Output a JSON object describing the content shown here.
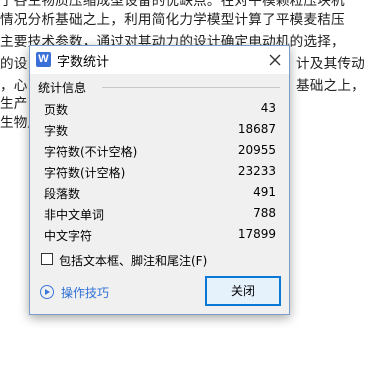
{
  "document": {
    "lines": [
      "了各生物质压缩成型设备的优缺点。在对平模颗粒压块机",
      "情况分析基础之上，利用简化力学模型计算了平模麦秸压",
      "主要技术参数，通过对其动力的设计确定电动机的选择，",
      "的设",
      "计及其传动",
      "，心",
      "基础之上，",
      "生产",
      "生物质"
    ]
  },
  "dialog": {
    "title": "字数统计",
    "app_icon_letter": "W",
    "group_label": "统计信息",
    "stats": [
      {
        "label": "页数",
        "value": "43"
      },
      {
        "label": "字数",
        "value": "18687"
      },
      {
        "label": "字符数(不计空格)",
        "value": "20955"
      },
      {
        "label": "字符数(计空格)",
        "value": "23233"
      },
      {
        "label": "段落数",
        "value": "491"
      },
      {
        "label": "非中文单词",
        "value": "788"
      },
      {
        "label": "中文字符",
        "value": "17899"
      }
    ],
    "checkbox_label": "包括文本框、脚注和尾注(F)",
    "checkbox_checked": false,
    "tips_link": "操作技巧",
    "close_button": "关闭",
    "colors": {
      "accent": "#0a78d7",
      "link": "#2f6fd6",
      "app_icon": "#3a6fd8"
    }
  }
}
